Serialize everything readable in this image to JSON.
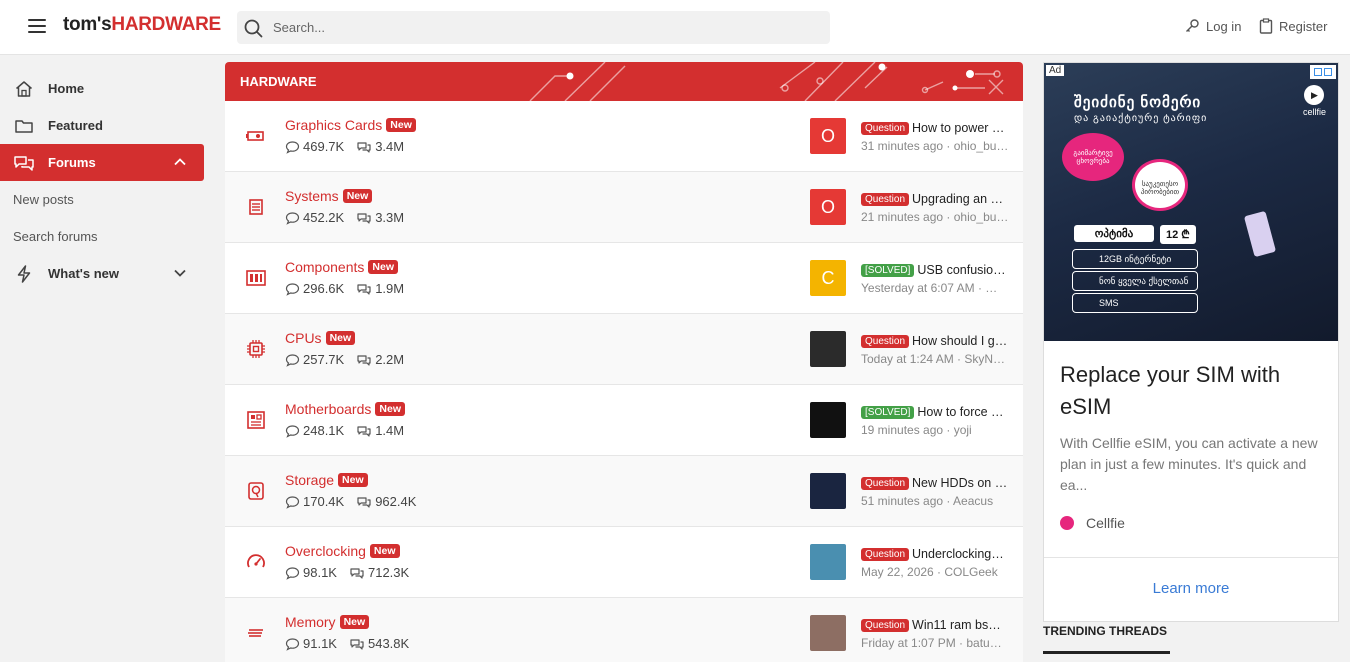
{
  "header": {
    "logo_part1": "tom's",
    "logo_part2": "HARDWARE",
    "search_placeholder": "Search...",
    "login": "Log in",
    "register": "Register"
  },
  "sidebar": {
    "home": "Home",
    "featured": "Featured",
    "forums": "Forums",
    "new_posts": "New posts",
    "search_forums": "Search forums",
    "whats_new": "What's new"
  },
  "section_title": "HARDWARE",
  "new_badge": "New",
  "forums": [
    {
      "title": "Graphics Cards",
      "messages": "469.7K",
      "threads": "3.4M",
      "avatar_letter": "O",
      "avatar_color": "#e53935",
      "prefix": "Question",
      "prefix_type": "q",
      "latest": "How to power …",
      "meta": "31 minutes ago · ohio_bu…",
      "icon": "gpu-icon"
    },
    {
      "title": "Systems",
      "messages": "452.2K",
      "threads": "3.3M",
      "avatar_letter": "O",
      "avatar_color": "#e53935",
      "prefix": "Question",
      "prefix_type": "q",
      "latest": "Upgrading an …",
      "meta": "21 minutes ago · ohio_bu…",
      "icon": "server-icon"
    },
    {
      "title": "Components",
      "messages": "296.6K",
      "threads": "1.9M",
      "avatar_letter": "C",
      "avatar_color": "#f4b400",
      "prefix": "[SOLVED]",
      "prefix_type": "s",
      "latest": "USB confusio…",
      "meta": "Yesterday at 6:07 AM · …",
      "icon": "components-icon"
    },
    {
      "title": "CPUs",
      "messages": "257.7K",
      "threads": "2.2M",
      "avatar_letter": "",
      "avatar_color": "#2b2b2b",
      "prefix": "Question",
      "prefix_type": "q",
      "latest": "How should I g…",
      "meta": "Today at 1:24 AM · SkyN…",
      "icon": "cpu-icon"
    },
    {
      "title": "Motherboards",
      "messages": "248.1K",
      "threads": "1.4M",
      "avatar_letter": "",
      "avatar_color": "#111111",
      "prefix": "[SOLVED]",
      "prefix_type": "s",
      "latest": "How to force …",
      "meta": "19 minutes ago · yoji",
      "icon": "motherboard-icon"
    },
    {
      "title": "Storage",
      "messages": "170.4K",
      "threads": "962.4K",
      "avatar_letter": "",
      "avatar_color": "#1a2540",
      "prefix": "Question",
      "prefix_type": "q",
      "latest": "New HDDs on …",
      "meta": "51 minutes ago · Aeacus",
      "icon": "storage-icon"
    },
    {
      "title": "Overclocking",
      "messages": "98.1K",
      "threads": "712.3K",
      "avatar_letter": "",
      "avatar_color": "#4a8fb0",
      "prefix": "Question",
      "prefix_type": "q",
      "latest": "Underclocking…",
      "meta": "May 22, 2026 · COLGeek",
      "icon": "speedometer-icon"
    },
    {
      "title": "Memory",
      "messages": "91.1K",
      "threads": "543.8K",
      "avatar_letter": "",
      "avatar_color": "#8d6e63",
      "prefix": "Question",
      "prefix_type": "q",
      "latest": "Win11 ram bs…",
      "meta": "Friday at 1:07 PM · batu…",
      "icon": "memory-icon"
    }
  ],
  "ad": {
    "tag": "Ad",
    "brand_top": "cellfie",
    "headline1": "შეიძინე ნომერი",
    "headline2": "და გაიაქტიურე ტარიფი",
    "bubble1": "გაიმარტივე ცხოვრება",
    "bubble2": "საუკეთესო პირობებით",
    "pill_left": "ოპტიმა",
    "pill_right": "12 ₾",
    "feature1": "12GB ინტერნეტი",
    "feature2": "ნონ ყველა ქსელთან",
    "feature3": "SMS",
    "title": "Replace your SIM with eSIM",
    "description": "With Cellfie eSIM, you can activate a new plan in just a few minutes. It's quick and ea...",
    "advertiser": "Cellfie",
    "cta": "Learn more"
  },
  "trending": "TRENDING THREADS"
}
